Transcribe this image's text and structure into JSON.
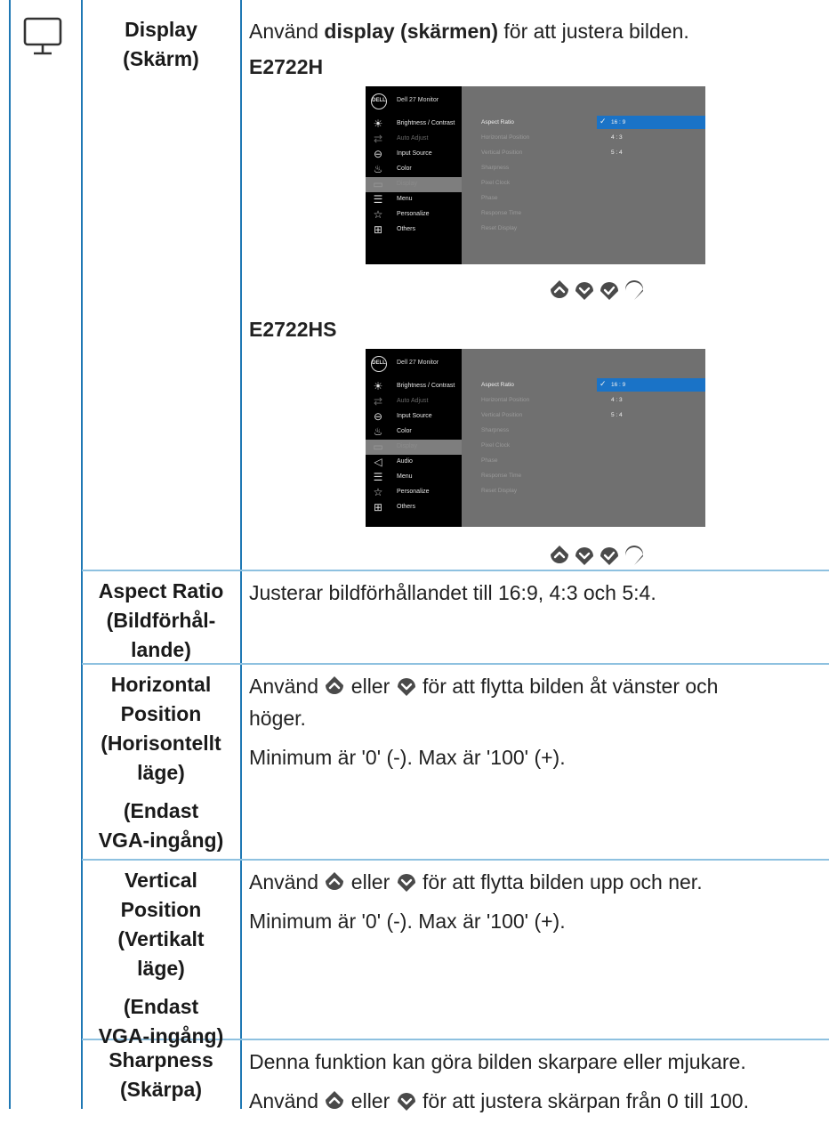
{
  "display": {
    "name": [
      "Display",
      "(Skärm)"
    ],
    "desc_pre": "Använd ",
    "desc_bold": "display (skärmen)",
    "desc_post": " för att justera bilden."
  },
  "models": [
    "E2722H",
    "E2722HS"
  ],
  "osd": {
    "logo": "DELL",
    "title": "Dell 27 Monitor",
    "menu_h": [
      {
        "label": "Brightness / Contrast",
        "icon": "sun-icon",
        "state": "normal"
      },
      {
        "label": "Auto Adjust",
        "icon": "auto-adjust-icon",
        "state": "dim"
      },
      {
        "label": "Input Source",
        "icon": "input-source-icon",
        "state": "normal"
      },
      {
        "label": "Color",
        "icon": "color-icon",
        "state": "normal"
      },
      {
        "label": "Display",
        "icon": "display-icon",
        "state": "selected"
      },
      {
        "label": "Menu",
        "icon": "menu-icon",
        "state": "normal"
      },
      {
        "label": "Personalize",
        "icon": "star-icon",
        "state": "normal"
      },
      {
        "label": "Others",
        "icon": "others-icon",
        "state": "normal"
      }
    ],
    "menu_hs": [
      {
        "label": "Brightness / Contrast",
        "icon": "sun-icon",
        "state": "normal"
      },
      {
        "label": "Auto Adjust",
        "icon": "auto-adjust-icon",
        "state": "dim"
      },
      {
        "label": "Input Source",
        "icon": "input-source-icon",
        "state": "normal"
      },
      {
        "label": "Color",
        "icon": "color-icon",
        "state": "normal"
      },
      {
        "label": "Display",
        "icon": "display-icon",
        "state": "selected"
      },
      {
        "label": "Audio",
        "icon": "speaker-icon",
        "state": "normal"
      },
      {
        "label": "Menu",
        "icon": "menu-icon",
        "state": "normal"
      },
      {
        "label": "Personalize",
        "icon": "star-icon",
        "state": "normal"
      },
      {
        "label": "Others",
        "icon": "others-icon",
        "state": "normal"
      }
    ],
    "submenu": [
      "Aspect Ratio",
      "Horizontal Position",
      "Vertical Position",
      "Sharpness",
      "Pixel Clock",
      "Phase",
      "Response Time",
      "Reset Display"
    ],
    "options": [
      "16 : 9",
      "4 : 3",
      "5 : 4"
    ]
  },
  "rows": {
    "aspect": {
      "name": [
        "Aspect Ratio",
        "(Bildförhål-",
        "lande)"
      ],
      "desc": "Justerar bildförhållandet till 16:9, 4:3 och 5:4."
    },
    "horizontal": {
      "name": [
        "Horizontal",
        "Position",
        "(Horisontellt",
        "läge)"
      ],
      "note": [
        "(Endast",
        "VGA-ingång)"
      ],
      "desc_a": "Använd ",
      "desc_b": " eller ",
      "desc_c": " för att flytta bilden åt vänster och",
      "desc_d": "höger.",
      "desc2": "Minimum är '0' (-). Max är '100' (+)."
    },
    "vertical": {
      "name": [
        "Vertical",
        "Position",
        "(Vertikalt",
        "läge)"
      ],
      "note": [
        "(Endast",
        "VGA-ingång)"
      ],
      "desc_a": "Använd ",
      "desc_b": " eller ",
      "desc_c": " för att flytta bilden upp och ner.",
      "desc2": "Minimum är '0' (-). Max är '100' (+)."
    },
    "sharpness": {
      "name": [
        "Sharpness",
        "(Skärpa)"
      ],
      "desc1": "Denna funktion kan göra bilden skarpare eller mjukare.",
      "desc_a": "Använd ",
      "desc_b": " eller ",
      "desc_c": " för att justera skärpan från 0 till 100."
    }
  },
  "colors": {
    "rule": "#1f78b4",
    "row_divider": "#8ec1e0",
    "osd_highlight": "#1a73c7",
    "nav_button": "#4a4a4a"
  }
}
